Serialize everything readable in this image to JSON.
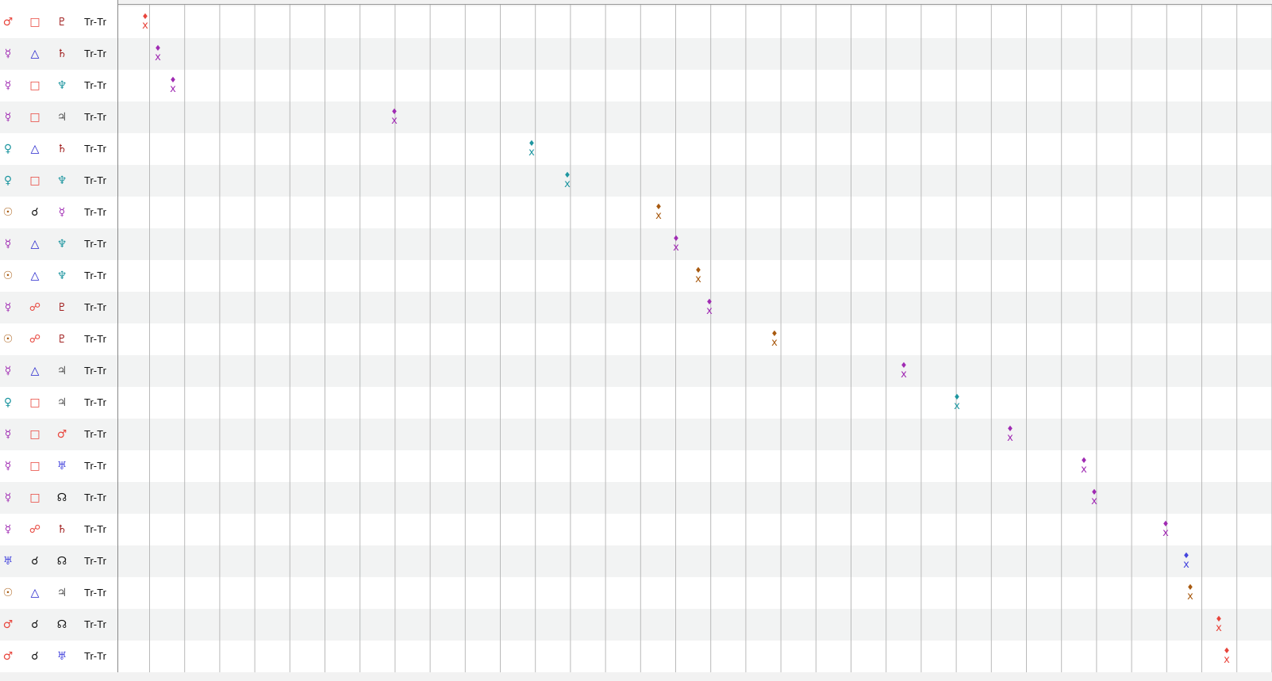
{
  "colors": {
    "mars": "#e8453c",
    "mercury": "#a02bb3",
    "venus": "#1e96a0",
    "sun": "#a85a10",
    "uranus": "#4444dd",
    "pluto": "#a01e1e",
    "saturn": "#a01e1e",
    "neptune": "#1e96a0",
    "jupiter": "#555555",
    "node": "#111111",
    "square": "#e8453c",
    "trine": "#2222cc",
    "opposition": "#e8453c",
    "conjunction": "#111111"
  },
  "glyphs": {
    "mars": "♂",
    "mercury": "☿",
    "venus": "♀",
    "sun": "☉",
    "uranus": "♅",
    "pluto": "♇",
    "saturn": "♄",
    "neptune": "♆",
    "jupiter": "♃",
    "node": "☊",
    "square": "□",
    "trine": "△",
    "opposition": "☍",
    "conjunction": "☌"
  },
  "marker_symbols": {
    "diamond": "♦",
    "x": "x"
  },
  "rows": [
    {
      "p1": "mars",
      "aspect": "square",
      "p2": "pluto",
      "label": "Tr-Tr",
      "marker_pos": 0.024
    },
    {
      "p1": "mercury",
      "aspect": "trine",
      "p2": "saturn",
      "label": "Tr-Tr",
      "marker_pos": 0.035
    },
    {
      "p1": "mercury",
      "aspect": "square",
      "p2": "neptune",
      "label": "Tr-Tr",
      "marker_pos": 0.048
    },
    {
      "p1": "mercury",
      "aspect": "square",
      "p2": "jupiter",
      "label": "Tr-Tr",
      "marker_pos": 0.24
    },
    {
      "p1": "venus",
      "aspect": "trine",
      "p2": "saturn",
      "label": "Tr-Tr",
      "marker_pos": 0.359
    },
    {
      "p1": "venus",
      "aspect": "square",
      "p2": "neptune",
      "label": "Tr-Tr",
      "marker_pos": 0.39
    },
    {
      "p1": "sun",
      "aspect": "conjunction",
      "p2": "mercury",
      "label": "Tr-Tr",
      "marker_pos": 0.469
    },
    {
      "p1": "mercury",
      "aspect": "trine",
      "p2": "neptune",
      "label": "Tr-Tr",
      "marker_pos": 0.484
    },
    {
      "p1": "sun",
      "aspect": "trine",
      "p2": "neptune",
      "label": "Tr-Tr",
      "marker_pos": 0.503
    },
    {
      "p1": "mercury",
      "aspect": "opposition",
      "p2": "pluto",
      "label": "Tr-Tr",
      "marker_pos": 0.513
    },
    {
      "p1": "sun",
      "aspect": "opposition",
      "p2": "pluto",
      "label": "Tr-Tr",
      "marker_pos": 0.569
    },
    {
      "p1": "mercury",
      "aspect": "trine",
      "p2": "jupiter",
      "label": "Tr-Tr",
      "marker_pos": 0.681
    },
    {
      "p1": "venus",
      "aspect": "square",
      "p2": "jupiter",
      "label": "Tr-Tr",
      "marker_pos": 0.727
    },
    {
      "p1": "mercury",
      "aspect": "square",
      "p2": "mars",
      "label": "Tr-Tr",
      "marker_pos": 0.773
    },
    {
      "p1": "mercury",
      "aspect": "square",
      "p2": "uranus",
      "label": "Tr-Tr",
      "marker_pos": 0.837
    },
    {
      "p1": "mercury",
      "aspect": "square",
      "p2": "node",
      "label": "Tr-Tr",
      "marker_pos": 0.846
    },
    {
      "p1": "mercury",
      "aspect": "opposition",
      "p2": "saturn",
      "label": "Tr-Tr",
      "marker_pos": 0.908
    },
    {
      "p1": "uranus",
      "aspect": "conjunction",
      "p2": "node",
      "label": "Tr-Tr",
      "marker_pos": 0.926
    },
    {
      "p1": "sun",
      "aspect": "trine",
      "p2": "jupiter",
      "label": "Tr-Tr",
      "marker_pos": 0.929
    },
    {
      "p1": "mars",
      "aspect": "conjunction",
      "p2": "node",
      "label": "Tr-Tr",
      "marker_pos": 0.954
    },
    {
      "p1": "mars",
      "aspect": "conjunction",
      "p2": "uranus",
      "label": "Tr-Tr",
      "marker_pos": 0.961
    }
  ]
}
